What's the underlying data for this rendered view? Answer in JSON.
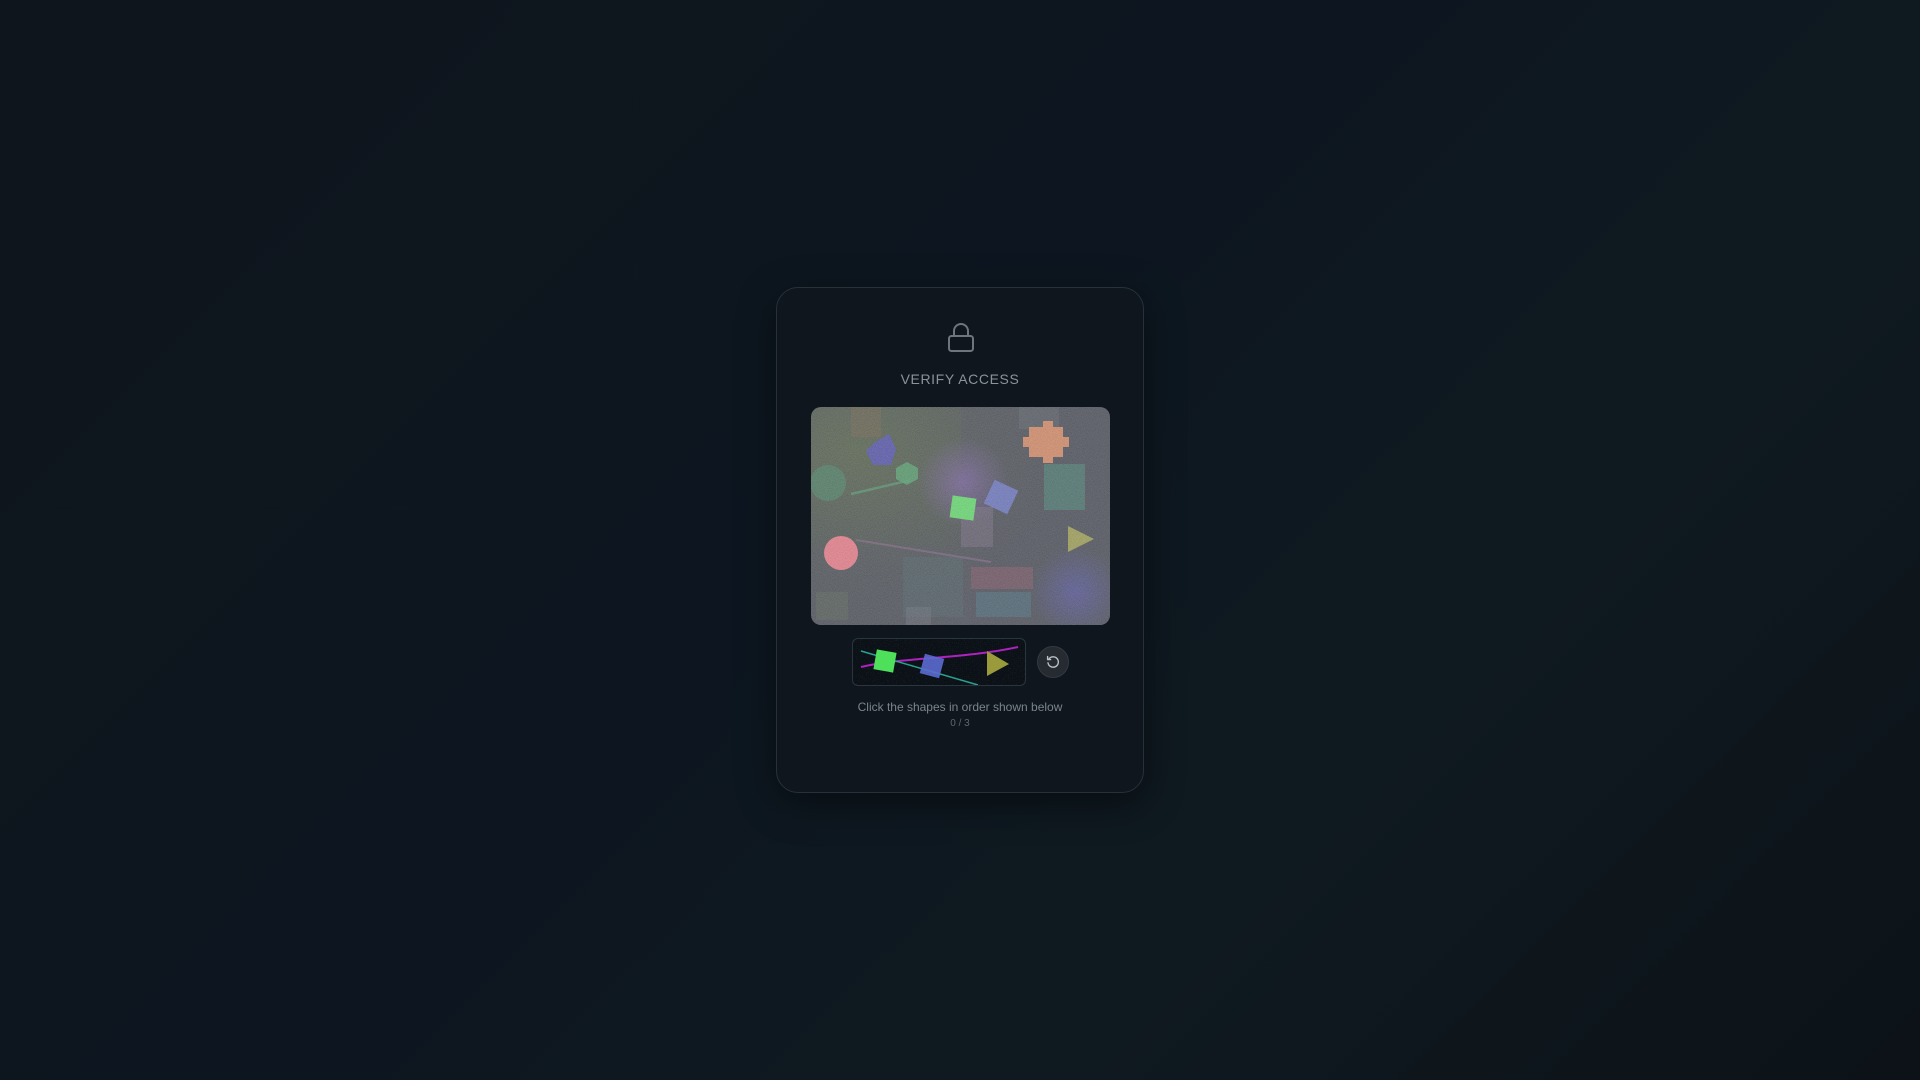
{
  "header": {
    "icon": "lock-icon",
    "title": "VERIFY ACCESS"
  },
  "challenge": {
    "instruction": "Click the shapes in order shown below",
    "progress": "0 / 3",
    "sequence": [
      "green-square",
      "blue-square",
      "olive-triangle"
    ]
  },
  "controls": {
    "refresh_icon": "refresh-icon"
  },
  "colors": {
    "background": "#0e151c",
    "card": "#0f161d",
    "text": "#8a939c"
  }
}
